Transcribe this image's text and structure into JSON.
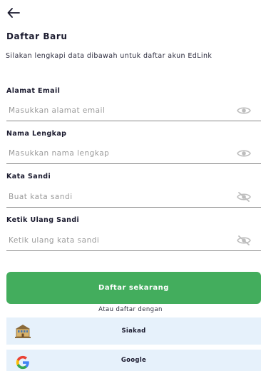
{
  "header": {
    "title": "Daftar Baru",
    "subtitle": "Silakan lengkapi data dibawah untuk daftar akun EdLink"
  },
  "fields": [
    {
      "label": "Alamat Email",
      "placeholder": "Masukkan alamat email",
      "value": "",
      "icon": "eye-icon"
    },
    {
      "label": "Nama Lengkap",
      "placeholder": "Masukkan nama lengkap",
      "value": "",
      "icon": "eye-icon"
    },
    {
      "label": "Kata Sandi",
      "placeholder": "Buat kata sandi",
      "value": "",
      "icon": "eye-off-icon"
    },
    {
      "label": "Ketik Ulang Sandi",
      "placeholder": "Ketik ulang kata sandi",
      "value": "",
      "icon": "eye-off-icon"
    }
  ],
  "actions": {
    "register_label": "Daftar sekarang",
    "alt_text": "Atau daftar dengan",
    "siakad_label": "Siakad",
    "google_label": "Google"
  },
  "colors": {
    "primary": "#43ad5d",
    "alt_bg": "#e6f1fb",
    "text": "#1a1a2e"
  }
}
